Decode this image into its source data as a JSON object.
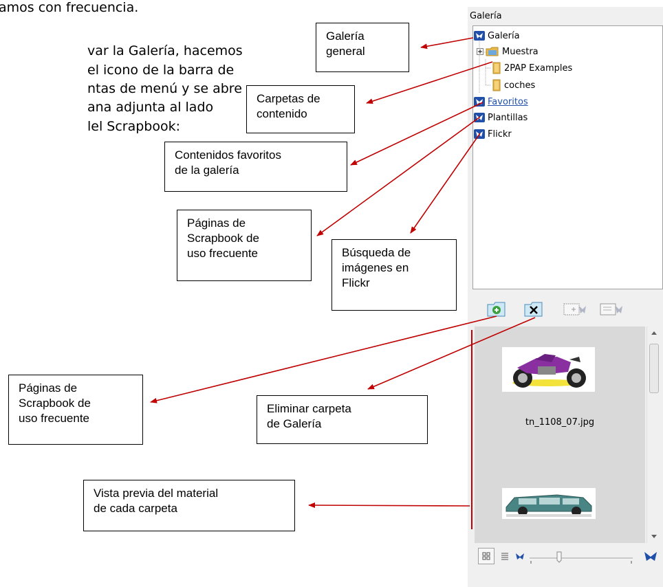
{
  "document": {
    "lines": [
      "amos con frecuencia.",
      "var la Galería, hacemos",
      "el icono de la barra de",
      "ntas de menú y se abre",
      "ana adjunta al lado",
      "lel Scrapbook:"
    ]
  },
  "callouts": {
    "galeria_general": "Galería\ngeneral",
    "carpetas_contenido": "Carpetas de\ncontenido",
    "contenidos_favoritos": "Contenidos favoritos\nde la galería",
    "paginas_scrapbook_1": "Páginas de\nScrapbook  de\nuso frecuente",
    "busqueda_flickr": "Búsqueda de\nimágenes en\nFlickr",
    "paginas_scrapbook_2": "Páginas de\nScrapbook  de\nuso frecuente",
    "eliminar_carpeta": "Eliminar carpeta\nde Galería",
    "vista_previa": "Vista previa del material\nde cada carpeta"
  },
  "gallery_panel": {
    "header": "Galería",
    "tree": [
      {
        "label": "Galería",
        "icon": "butterfly-icon"
      },
      {
        "label": "Muestra",
        "icon": "folder-icon"
      },
      {
        "label": "2PAP Examples",
        "icon": "folder-icon"
      },
      {
        "label": "coches",
        "icon": "folder-icon"
      },
      {
        "label": "Favoritos",
        "icon": "butterfly-icon"
      },
      {
        "label": "Plantillas",
        "icon": "butterfly-icon"
      },
      {
        "label": "Flickr",
        "icon": "butterfly-icon"
      }
    ],
    "toolbar": [
      "add-folder-icon",
      "delete-folder-icon",
      "add-page-icon",
      "remove-page-icon"
    ],
    "preview_items": [
      {
        "file_name": "tn_1108_07.jpg",
        "image": "motorcycle"
      },
      {
        "file_name": "",
        "image": "car"
      }
    ]
  },
  "colors": {
    "arrow": "#c00000",
    "butterfly": "#1f4fa8",
    "folder": "#e8b94a",
    "link": "#1f4fa8"
  }
}
